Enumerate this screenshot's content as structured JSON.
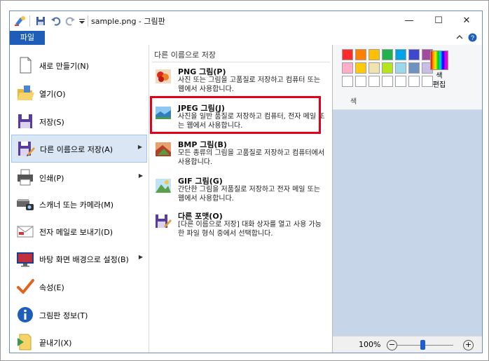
{
  "window": {
    "title": "sample.png - 그림판",
    "controls": [
      "—",
      "☐",
      "✕"
    ]
  },
  "ribbon": {
    "file_tab_label": "파일",
    "edit_colors_label": "색\n편집",
    "colors_group_label": "색",
    "palette_row1": [
      "#ff2b2b",
      "#ff7f00",
      "#ffc000",
      "#22b14c",
      "#00a2e8",
      "#3f48cc",
      "#a349a4"
    ],
    "palette_row2": [
      "#ffaec9",
      "#ffc90e",
      "#efe4b0",
      "#b5e61d",
      "#99d9ea",
      "#7092be",
      "#c8bfe7"
    ],
    "palette_empty": [
      "#ffffff",
      "#ffffff",
      "#ffffff",
      "#ffffff",
      "#ffffff",
      "#ffffff",
      "#ffffff"
    ]
  },
  "status": {
    "zoom": "100%",
    "zoom_minus": "−",
    "zoom_plus": "+"
  },
  "menu": {
    "items": [
      {
        "label": "새로 만들기(N)",
        "icon": "new-document-icon"
      },
      {
        "label": "열기(O)",
        "icon": "open-folder-icon"
      },
      {
        "label": "저장(S)",
        "icon": "save-disk-icon"
      },
      {
        "label": "다른 이름으로 저장(A)",
        "icon": "save-as-icon"
      },
      {
        "label": "인쇄(P)",
        "icon": "printer-icon"
      },
      {
        "label": "스캐너 또는 카메라(M)",
        "icon": "scanner-icon"
      },
      {
        "label": "전자 메일로 보내기(D)",
        "icon": "email-icon"
      },
      {
        "label": "바탕 화면 배경으로 설정(B)",
        "icon": "desktop-background-icon"
      },
      {
        "label": "속성(E)",
        "icon": "checkmark-icon"
      },
      {
        "label": "그림판 정보(T)",
        "icon": "info-icon"
      },
      {
        "label": "끝내기(X)",
        "icon": "exit-icon"
      }
    ],
    "submenu": {
      "title": "다른 이름으로 저장",
      "items": [
        {
          "heading": "PNG 그림(P)",
          "desc": "사진 또는 그림을 고품질로 저장하고 컴퓨터 또는 웹에서 사용합니다.",
          "icon": "png-image-icon"
        },
        {
          "heading": "JPEG 그림(J)",
          "desc": "사진을 일반 품질로 저장하고 컴퓨터, 전자 메일 또는 웹에서 사용합니다.",
          "icon": "jpeg-image-icon"
        },
        {
          "heading": "BMP 그림(B)",
          "desc": "모든 종류의 그림을 고품질로 저장하고 컴퓨터에서 사용합니다.",
          "icon": "bmp-image-icon"
        },
        {
          "heading": "GIF 그림(G)",
          "desc": "간단한 그림을 저품질로 저장하고 전자 메일 또는 웹에서 사용합니다.",
          "icon": "gif-image-icon"
        },
        {
          "heading": "다른 포맷(O)",
          "desc": "[다른 이름으로 저장] 대화 상자를 열고 사용 가능한 파일 형식 중에서 선택합니다.",
          "icon": "other-format-icon"
        }
      ]
    }
  },
  "colors": {
    "file_tab": "#1e5eb8",
    "highlight": "#e3001b",
    "selected_item": "#dbe6f5",
    "canvas_bg": "#c7d5e8"
  }
}
